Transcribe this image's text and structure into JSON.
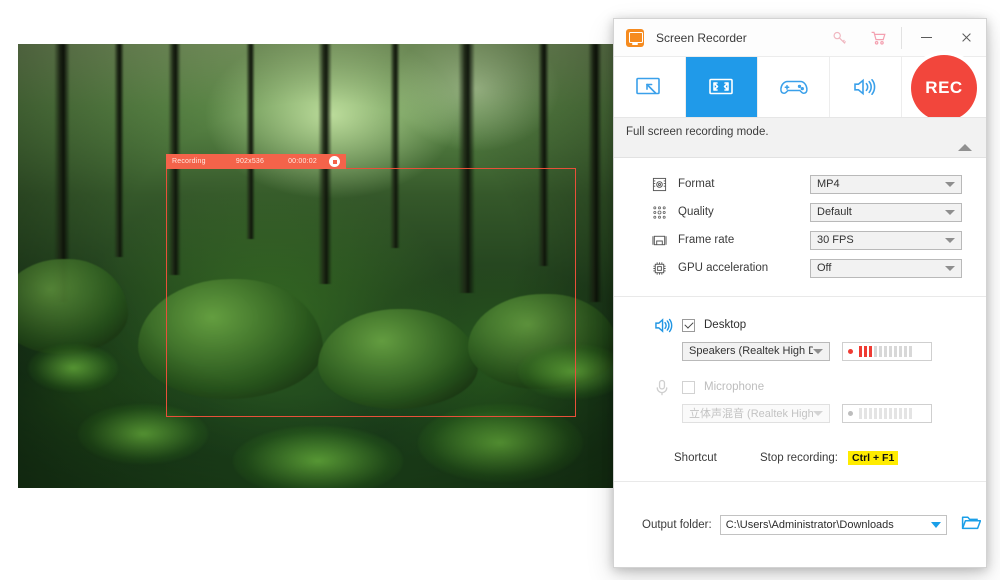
{
  "window": {
    "title": "Screen Recorder",
    "logo_icon": "screen-recorder-logo-icon",
    "key_icon": "key-icon",
    "cart_icon": "shopping-cart-icon",
    "minimize_label": "minimize-icon",
    "close_label": "close-icon"
  },
  "modes": [
    {
      "name": "custom-region",
      "icon": "custom-region-icon",
      "active": false
    },
    {
      "name": "full-screen",
      "icon": "full-screen-icon",
      "active": true
    },
    {
      "name": "game-mode",
      "icon": "game-controller-icon",
      "active": false
    },
    {
      "name": "audio-only",
      "icon": "speaker-icon",
      "active": false
    }
  ],
  "rec_button": {
    "label": "REC",
    "color": "#f2463c"
  },
  "mode_hint": "Full screen recording mode.",
  "collapse_icon": "chevron-up-icon",
  "settings": {
    "rows": [
      {
        "icon": "format-icon",
        "label": "Format",
        "value": "MP4"
      },
      {
        "icon": "quality-icon",
        "label": "Quality",
        "value": "Default"
      },
      {
        "icon": "framerate-icon",
        "label": "Frame rate",
        "value": "30 FPS"
      },
      {
        "icon": "gpu-icon",
        "label": "GPU acceleration",
        "value": "Off"
      }
    ]
  },
  "audio": {
    "desktop": {
      "icon": "speaker-on-icon",
      "label": "Desktop",
      "checked": true,
      "device": "Speakers (Realtek High De...",
      "meter": {
        "bars": 11,
        "active": 3
      }
    },
    "microphone": {
      "icon": "microphone-icon",
      "label": "Microphone",
      "checked": false,
      "device": "立体声混音 (Realtek High D...",
      "meter": {
        "bars": 11,
        "active": 0
      }
    }
  },
  "shortcut": {
    "title": "Shortcut",
    "action_label": "Stop recording:",
    "keys": "Ctrl + F1",
    "highlight_color": "#ffec00"
  },
  "output": {
    "label": "Output folder:",
    "path": "C:\\Users\\Administrator\\Downloads",
    "browse_icon": "folder-open-icon"
  },
  "overlay": {
    "status": "Recording",
    "dimensions": "902x536",
    "elapsed": "00:00:02",
    "stop_icon": "stop-recording-icon",
    "border_color": "#e8503a"
  }
}
